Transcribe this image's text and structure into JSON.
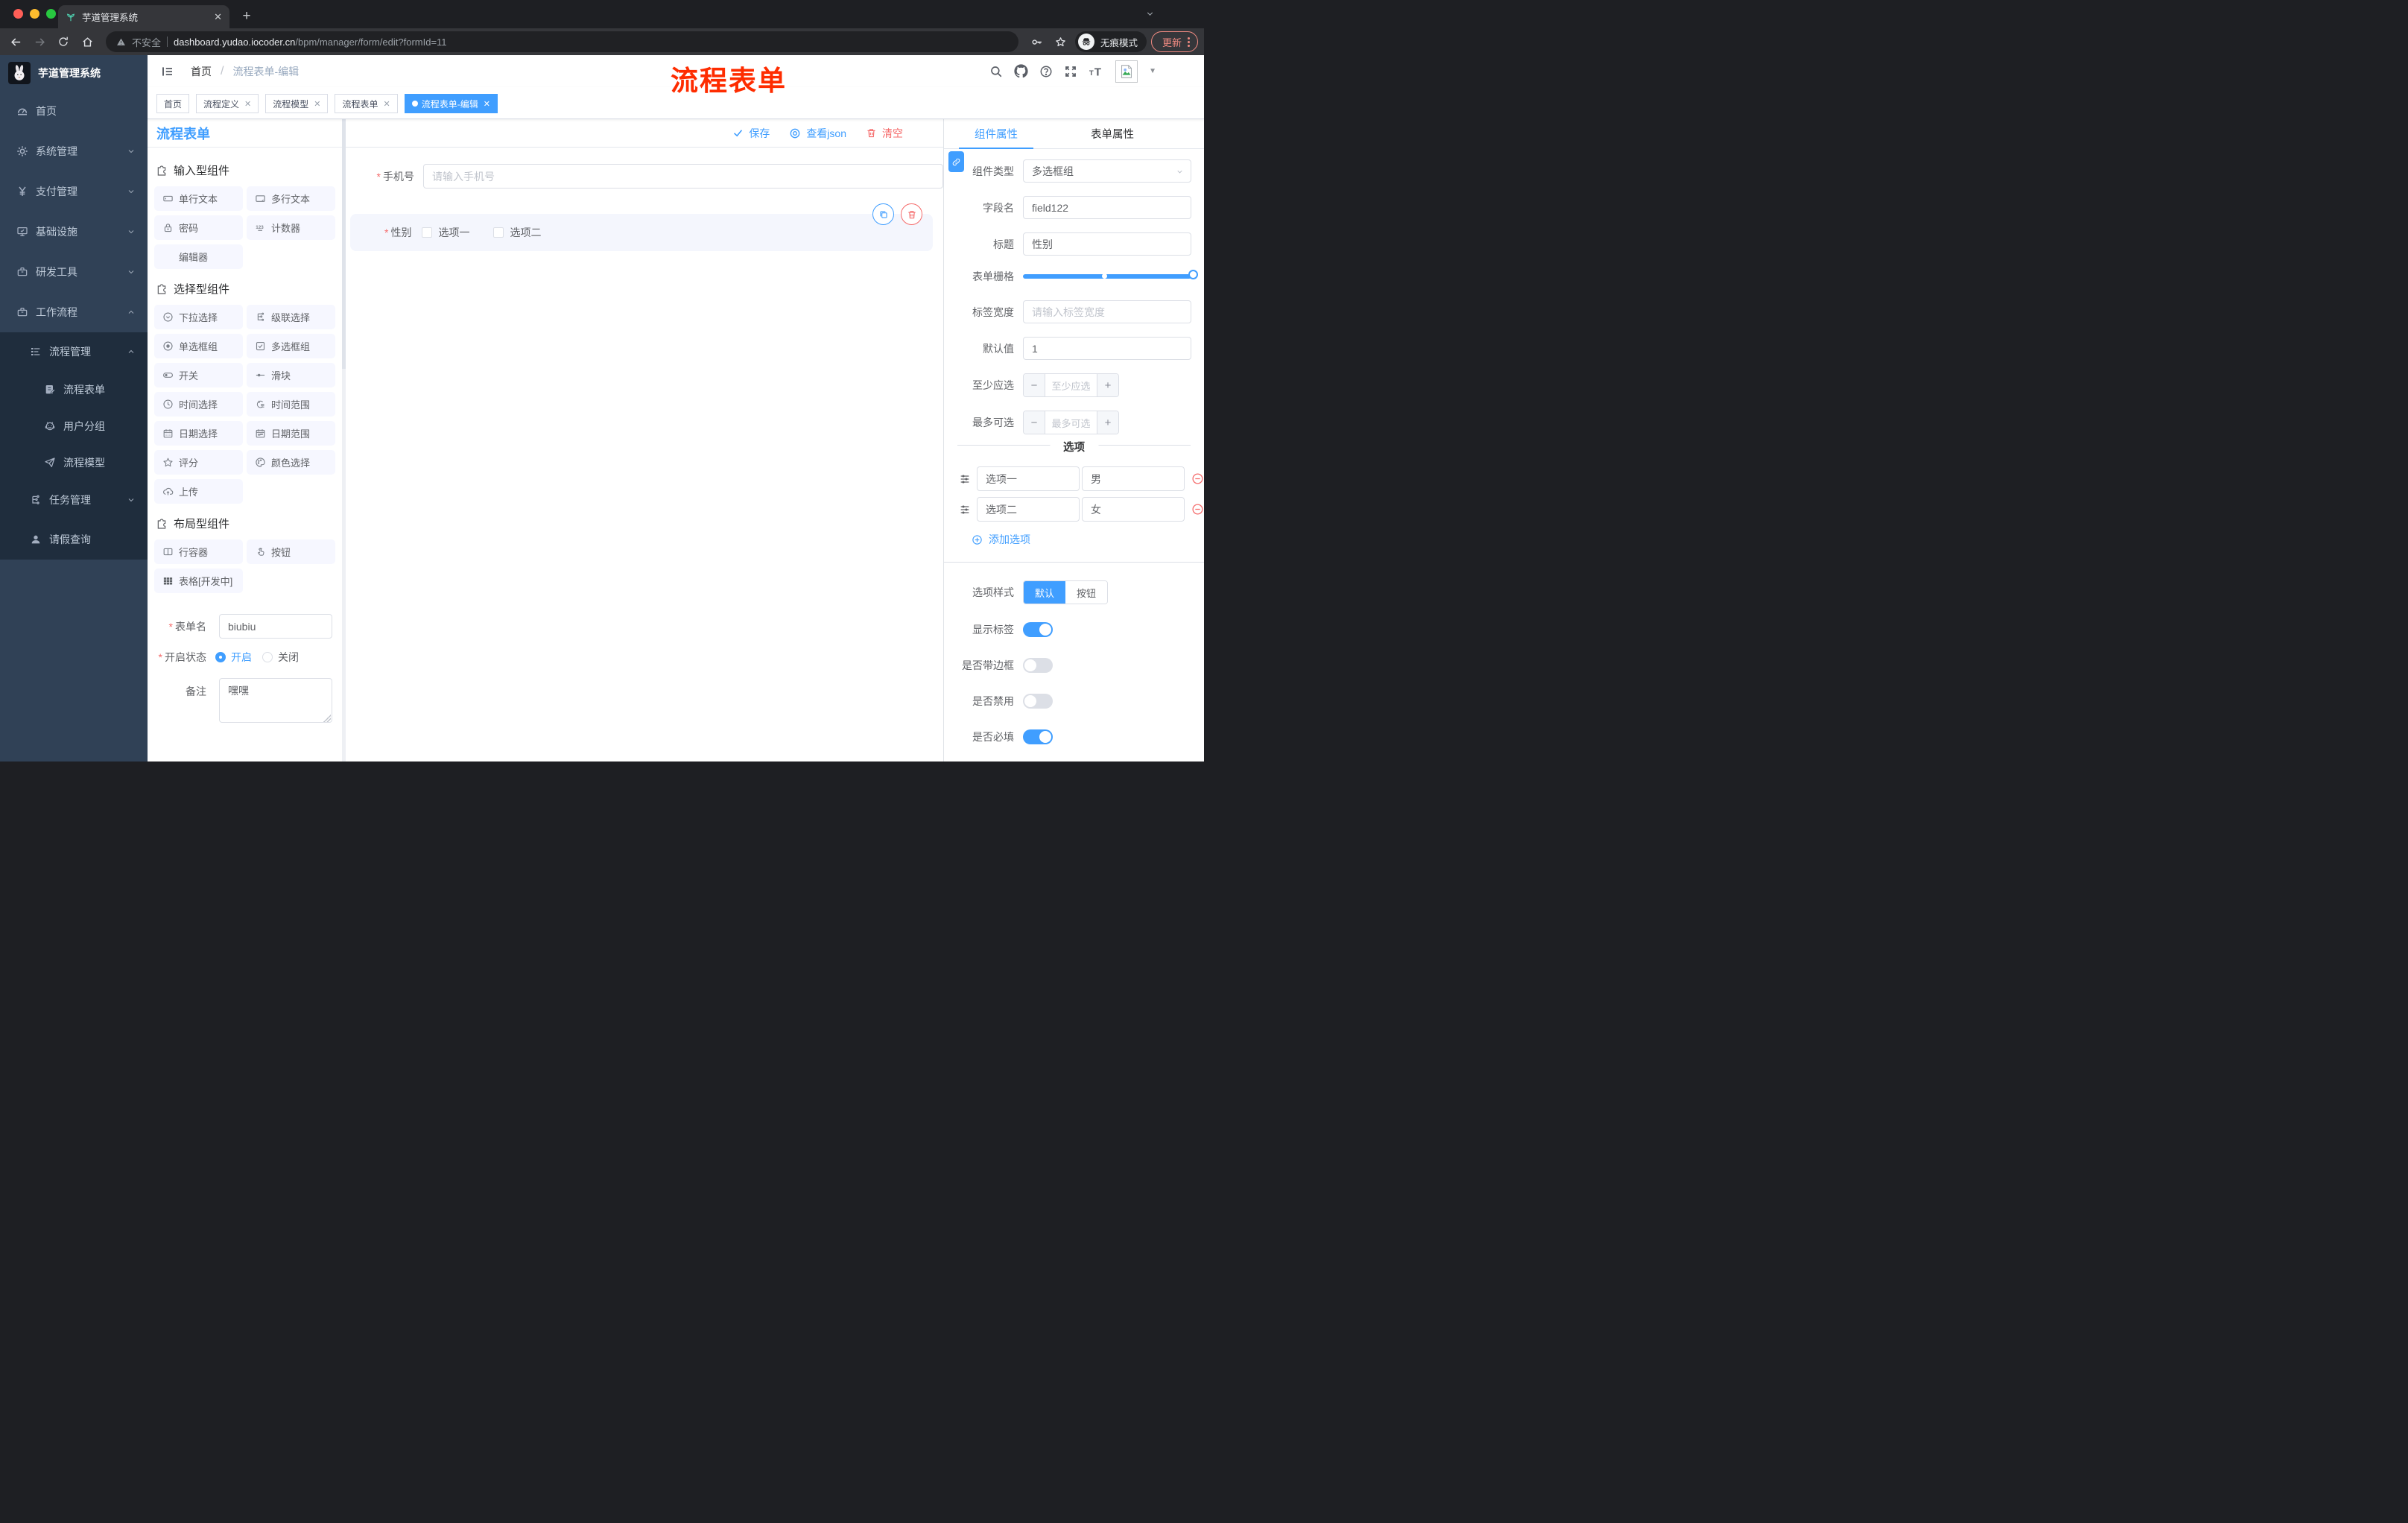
{
  "colors": {
    "primary": "#409EFF",
    "danger": "#F56C6C",
    "annotation_red": "#FE2C00",
    "sidebar_bg": "#304156",
    "sidebar_submenu_bg": "#1F2D3D",
    "tag_active_bg": "#409EFF"
  },
  "browser": {
    "tab_title": "芋道管理系统",
    "security_label": "不安全",
    "url_host": "dashboard.yudao.iocoder.cn",
    "url_path": "/bpm/manager/form/edit?formId=11",
    "incognito_label": "无痕模式",
    "update_label": "更新"
  },
  "sidebar": {
    "logo_title": "芋道管理系统",
    "items": [
      {
        "label": "首页"
      },
      {
        "label": "系统管理"
      },
      {
        "label": "支付管理"
      },
      {
        "label": "基础设施"
      },
      {
        "label": "研发工具"
      },
      {
        "label": "工作流程"
      },
      {
        "label": "流程管理"
      },
      {
        "label": "流程表单"
      },
      {
        "label": "用户分组"
      },
      {
        "label": "流程模型"
      },
      {
        "label": "任务管理"
      },
      {
        "label": "请假查询"
      }
    ]
  },
  "header": {
    "breadcrumb": {
      "home": "首页",
      "current": "流程表单-编辑"
    },
    "annotation": "流程表单"
  },
  "tags": [
    {
      "label": "首页"
    },
    {
      "label": "流程定义"
    },
    {
      "label": "流程模型"
    },
    {
      "label": "流程表单"
    },
    {
      "label": "流程表单-编辑"
    }
  ],
  "palette": {
    "title": "流程表单",
    "sections": [
      {
        "title": "输入型组件",
        "items": [
          {
            "label": "单行文本"
          },
          {
            "label": "多行文本"
          },
          {
            "label": "密码"
          },
          {
            "label": "计数器"
          },
          {
            "label": "编辑器"
          }
        ]
      },
      {
        "title": "选择型组件",
        "items": [
          {
            "label": "下拉选择"
          },
          {
            "label": "级联选择"
          },
          {
            "label": "单选框组"
          },
          {
            "label": "多选框组"
          },
          {
            "label": "开关"
          },
          {
            "label": "滑块"
          },
          {
            "label": "时间选择"
          },
          {
            "label": "时间范围"
          },
          {
            "label": "日期选择"
          },
          {
            "label": "日期范围"
          },
          {
            "label": "评分"
          },
          {
            "label": "颜色选择"
          },
          {
            "label": "上传"
          }
        ]
      },
      {
        "title": "布局型组件",
        "items": [
          {
            "label": "行容器"
          },
          {
            "label": "按钮"
          },
          {
            "label": "表格[开发中]"
          }
        ]
      }
    ],
    "meta": {
      "form_name_label": "表单名",
      "form_name_value": "biubiu",
      "status_label": "开启状态",
      "status_on": "开启",
      "status_off": "关闭",
      "remark_label": "备注",
      "remark_value": "嘿嘿"
    }
  },
  "canvas": {
    "toolbar": {
      "save": "保存",
      "view_json": "查看json",
      "clear": "清空"
    },
    "phone_field": {
      "label": "手机号",
      "placeholder": "请输入手机号"
    },
    "selected_field": {
      "label": "性别",
      "option1": "选项一",
      "option2": "选项二"
    }
  },
  "props": {
    "tab_component": "组件属性",
    "tab_form": "表单属性",
    "component_type": {
      "label": "组件类型",
      "value": "多选框组"
    },
    "field_name": {
      "label": "字段名",
      "value": "field122"
    },
    "title": {
      "label": "标题",
      "value": "性别"
    },
    "grid": {
      "label": "表单栅格"
    },
    "label_width": {
      "label": "标签宽度",
      "placeholder": "请输入标签宽度"
    },
    "default_value": {
      "label": "默认值",
      "value": "1"
    },
    "min_select": {
      "label": "至少应选",
      "placeholder": "至少应选"
    },
    "max_select": {
      "label": "最多可选",
      "placeholder": "最多可选"
    },
    "options_title": "选项",
    "options": [
      {
        "label": "选项一",
        "value": "男"
      },
      {
        "label": "选项二",
        "value": "女"
      }
    ],
    "add_option": "添加选项",
    "option_style": {
      "label": "选项样式",
      "default": "默认",
      "button": "按钮"
    },
    "switches": {
      "show_label": {
        "label": "显示标签",
        "on": true
      },
      "border": {
        "label": "是否带边框",
        "on": false
      },
      "disabled": {
        "label": "是否禁用",
        "on": false
      },
      "required": {
        "label": "是否必填",
        "on": true
      }
    }
  }
}
